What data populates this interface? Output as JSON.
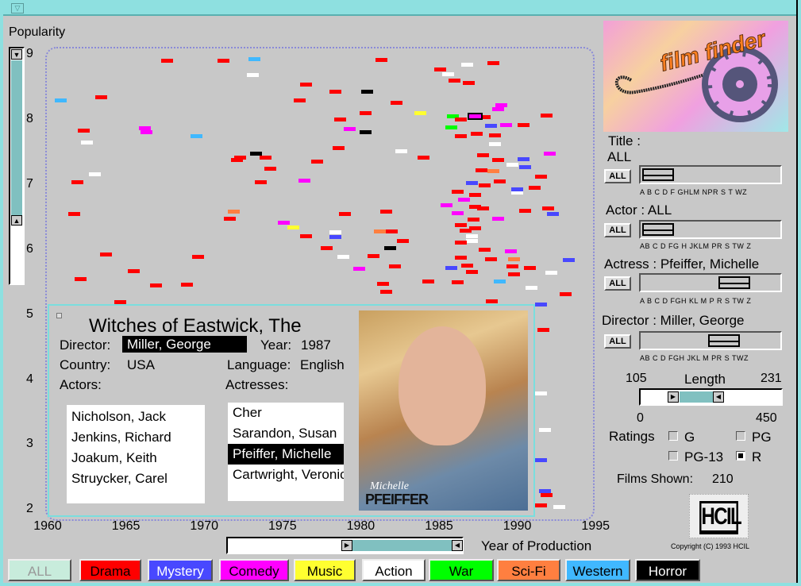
{
  "window": {
    "menu_icon": "triangle-down-icon"
  },
  "genre_colors": [
    "#ff0000",
    "#4848ff",
    "#ff00ff",
    "#ffff30",
    "#ffffff",
    "#00ff00",
    "#ff7f40",
    "#40b8ff",
    "#000000"
  ],
  "legend": {
    "all": "ALL",
    "genres": [
      "Drama",
      "Mystery",
      "Comedy",
      "Music",
      "Action",
      "War",
      "Sci-Fi",
      "Western",
      "Horror"
    ]
  },
  "y_axis": {
    "label": "Popularity",
    "ticks": [
      "9",
      "8",
      "7",
      "6",
      "5",
      "4",
      "3",
      "2"
    ],
    "range": [
      2,
      9
    ],
    "slider_range": [
      6.5,
      9
    ]
  },
  "x_axis": {
    "label": "Year of Production",
    "ticks": [
      "1960",
      "1965",
      "1970",
      "1975",
      "1980",
      "1985",
      "1990",
      "1995"
    ],
    "range": [
      1960,
      1995
    ],
    "slider_range": [
      1979,
      1995
    ]
  },
  "chart_data": {
    "type": "scatter",
    "xlabel": "Year of Production",
    "ylabel": "Popularity",
    "xlim": [
      1960,
      1995
    ],
    "ylim": [
      2,
      9
    ],
    "series_fields": [
      "year",
      "popularity",
      "genre_index"
    ],
    "selected": [
      1987.3,
      8.05,
      2
    ],
    "points": [
      [
        1967.6,
        8.9,
        0
      ],
      [
        1971.2,
        8.9,
        0
      ],
      [
        1973.2,
        8.93,
        7
      ],
      [
        1973.1,
        8.68,
        4
      ],
      [
        1981.3,
        8.91,
        0
      ],
      [
        1986.8,
        8.84,
        4
      ],
      [
        1988.5,
        8.87,
        0
      ],
      [
        1985.1,
        8.77,
        0
      ],
      [
        1985.6,
        8.7,
        4
      ],
      [
        1986,
        8.6,
        0
      ],
      [
        1986.9,
        8.56,
        0
      ],
      [
        1976.5,
        8.54,
        0
      ],
      [
        1980.4,
        8.43,
        8
      ],
      [
        1978.4,
        8.43,
        0
      ],
      [
        1963.4,
        8.34,
        0
      ],
      [
        1960.8,
        8.29,
        7
      ],
      [
        1976.1,
        8.29,
        0
      ],
      [
        1982.3,
        8.26,
        0
      ],
      [
        1989,
        8.22,
        2
      ],
      [
        1988.8,
        8.16,
        2
      ],
      [
        1980.3,
        8.1,
        0
      ],
      [
        1983.8,
        8.1,
        3
      ],
      [
        1985.9,
        8.05,
        5
      ],
      [
        1987.9,
        8.03,
        0
      ],
      [
        1978.7,
        8.0,
        0
      ],
      [
        1986.4,
        8.0,
        0
      ],
      [
        1991.9,
        8.06,
        0
      ],
      [
        1985.8,
        7.88,
        5
      ],
      [
        1979.3,
        7.85,
        2
      ],
      [
        1980.3,
        7.8,
        8
      ],
      [
        1988.3,
        7.9,
        1
      ],
      [
        1989.3,
        7.91,
        2
      ],
      [
        1990.4,
        7.91,
        0
      ],
      [
        1966.2,
        7.86,
        2
      ],
      [
        1966.3,
        7.8,
        2
      ],
      [
        1962.3,
        7.83,
        0
      ],
      [
        1969.5,
        7.74,
        7
      ],
      [
        1986.4,
        7.74,
        0
      ],
      [
        1987.4,
        7.78,
        0
      ],
      [
        1988.6,
        7.75,
        0
      ],
      [
        1962.5,
        7.64,
        4
      ],
      [
        1988.6,
        7.62,
        4
      ],
      [
        1978.6,
        7.56,
        0
      ],
      [
        1982.6,
        7.51,
        4
      ],
      [
        1992.1,
        7.47,
        2
      ],
      [
        1973.3,
        7.47,
        8
      ],
      [
        1972.3,
        7.41,
        0
      ],
      [
        1972.1,
        7.38,
        0
      ],
      [
        1973.9,
        7.41,
        0
      ],
      [
        1987.8,
        7.45,
        0
      ],
      [
        1984,
        7.41,
        0
      ],
      [
        1988.8,
        7.38,
        0
      ],
      [
        1990.4,
        7.39,
        1
      ],
      [
        1989.7,
        7.3,
        4
      ],
      [
        1990.5,
        7.27,
        1
      ],
      [
        1977.2,
        7.35,
        0
      ],
      [
        1974.2,
        7.24,
        0
      ],
      [
        1987.7,
        7.22,
        0
      ],
      [
        1988.5,
        7.2,
        6
      ],
      [
        1963,
        7.16,
        4
      ],
      [
        1991.5,
        7.12,
        0
      ],
      [
        1961.9,
        7.03,
        0
      ],
      [
        1973.6,
        7.03,
        0
      ],
      [
        1976.4,
        7.06,
        2
      ],
      [
        1987.1,
        7.02,
        1
      ],
      [
        1988.9,
        7.05,
        0
      ],
      [
        1987.9,
        6.98,
        0
      ],
      [
        1991.1,
        6.95,
        0
      ],
      [
        1990,
        6.88,
        4
      ],
      [
        1990,
        6.92,
        1
      ],
      [
        1986.2,
        6.89,
        0
      ],
      [
        1986.6,
        6.77,
        2
      ],
      [
        1987.3,
        6.84,
        0
      ],
      [
        1985.5,
        6.68,
        2
      ],
      [
        1987.3,
        6.66,
        0
      ],
      [
        1987.8,
        6.63,
        0
      ],
      [
        1992,
        6.63,
        0
      ],
      [
        1992.3,
        6.55,
        1
      ],
      [
        1971.9,
        6.58,
        6
      ],
      [
        1971.6,
        6.47,
        0
      ],
      [
        1961.7,
        6.55,
        0
      ],
      [
        1979,
        6.55,
        0
      ],
      [
        1981.6,
        6.58,
        0
      ],
      [
        1986.2,
        6.56,
        2
      ],
      [
        1990.5,
        6.6,
        0
      ],
      [
        1988.8,
        6.47,
        2
      ],
      [
        1987.2,
        6.46,
        0
      ],
      [
        1975.1,
        6.41,
        2
      ],
      [
        1975.7,
        6.34,
        3
      ],
      [
        1986.4,
        6.38,
        0
      ],
      [
        1987.3,
        6.33,
        0
      ],
      [
        1978.4,
        6.27,
        4
      ],
      [
        1978.4,
        6.19,
        1
      ],
      [
        1981.2,
        6.28,
        6
      ],
      [
        1982,
        6.28,
        0
      ],
      [
        1986.7,
        6.29,
        0
      ],
      [
        1987.1,
        6.2,
        4
      ],
      [
        1976.5,
        6.2,
        0
      ],
      [
        1982.7,
        6.13,
        0
      ],
      [
        1987.1,
        6.13,
        4
      ],
      [
        1986.4,
        6.11,
        0
      ],
      [
        1977.8,
        6.02,
        0
      ],
      [
        1981.9,
        6.02,
        8
      ],
      [
        1987.9,
        6.0,
        0
      ],
      [
        1989.6,
        5.97,
        2
      ],
      [
        1963.7,
        5.92,
        0
      ],
      [
        1969.6,
        5.89,
        0
      ],
      [
        1978.9,
        5.89,
        4
      ],
      [
        1980.8,
        5.9,
        0
      ],
      [
        1986.4,
        5.87,
        0
      ],
      [
        1988.3,
        5.85,
        0
      ],
      [
        1989.8,
        5.85,
        6
      ],
      [
        1993.3,
        5.84,
        1
      ],
      [
        1982.2,
        5.74,
        0
      ],
      [
        1979.9,
        5.7,
        2
      ],
      [
        1985.8,
        5.72,
        1
      ],
      [
        1986.8,
        5.75,
        0
      ],
      [
        1989.7,
        5.74,
        0
      ],
      [
        1990.8,
        5.72,
        0
      ],
      [
        1992.2,
        5.64,
        4
      ],
      [
        1965.5,
        5.67,
        0
      ],
      [
        1987.1,
        5.65,
        0
      ],
      [
        1989.8,
        5.62,
        0
      ],
      [
        1962.1,
        5.54,
        0
      ],
      [
        1984.3,
        5.51,
        0
      ],
      [
        1986.2,
        5.5,
        0
      ],
      [
        1988.9,
        5.51,
        7
      ],
      [
        1981.4,
        5.47,
        0
      ],
      [
        1966.9,
        5.45,
        0
      ],
      [
        1968.9,
        5.46,
        0
      ],
      [
        1990.9,
        5.41,
        4
      ],
      [
        1981.6,
        5.35,
        0
      ],
      [
        1993.1,
        5.31,
        0
      ],
      [
        1964.6,
        5.19,
        0
      ],
      [
        1988.4,
        5.2,
        0
      ],
      [
        1991.5,
        5.15,
        1
      ],
      [
        1991.7,
        4.76,
        0
      ],
      [
        1991.5,
        3.79,
        4
      ],
      [
        1991.8,
        3.22,
        4
      ],
      [
        1991.5,
        2.76,
        1
      ],
      [
        1991.8,
        2.28,
        1
      ],
      [
        1991.9,
        2.22,
        0
      ],
      [
        1992.7,
        2.04,
        4
      ],
      [
        1991.5,
        2.07,
        0
      ]
    ]
  },
  "details": {
    "title": "Witches of Eastwick, The",
    "director_label": "Director:",
    "director": "Miller, George",
    "year_label": "Year:",
    "year": "1987",
    "country_label": "Country:",
    "country": "USA",
    "language_label": "Language:",
    "language": "English",
    "actors_label": "Actors:",
    "actors": [
      "Nicholson, Jack",
      "Jenkins, Richard",
      "Joakum, Keith",
      "Struycker, Carel"
    ],
    "actresses_label": "Actresses:",
    "actresses": [
      "Cher",
      "Sarandon, Susan",
      "Pfeiffer, Michelle",
      "Cartwright, Veronica"
    ],
    "photo_caption_1": "Michelle",
    "photo_caption_2": "PFEIFFER"
  },
  "logo": {
    "text": "film finder"
  },
  "filters": {
    "all_label": "ALL",
    "title": {
      "label": "Title :",
      "value": "ALL",
      "alphabet": "A B C D F GHLM NPR S  T  WZ"
    },
    "actor": {
      "label": "Actor : ALL",
      "alphabet": "AB  C  D FG H JKLM  PR S  TW Z"
    },
    "actress": {
      "label": "Actress : Pfeiffer, Michelle",
      "alphabet": "A B  C  D FGH KL M  P R S  TW Z"
    },
    "director": {
      "label": "Director : Miller, George",
      "alphabet": "AB  C  D FGH JKL M  PR S  TWZ"
    }
  },
  "length": {
    "label": "Length",
    "low": "105",
    "high": "231",
    "min": "0",
    "max": "450"
  },
  "ratings": {
    "label": "Ratings",
    "options": [
      {
        "label": "G",
        "checked": false
      },
      {
        "label": "PG",
        "checked": false
      },
      {
        "label": "PG-13",
        "checked": false
      },
      {
        "label": "R",
        "checked": true
      }
    ]
  },
  "films_shown": {
    "label": "Films Shown:",
    "value": "210"
  },
  "hcil": {
    "logo_text": "HCIL",
    "copyright": "Copyright (C) 1993 HCIL"
  }
}
